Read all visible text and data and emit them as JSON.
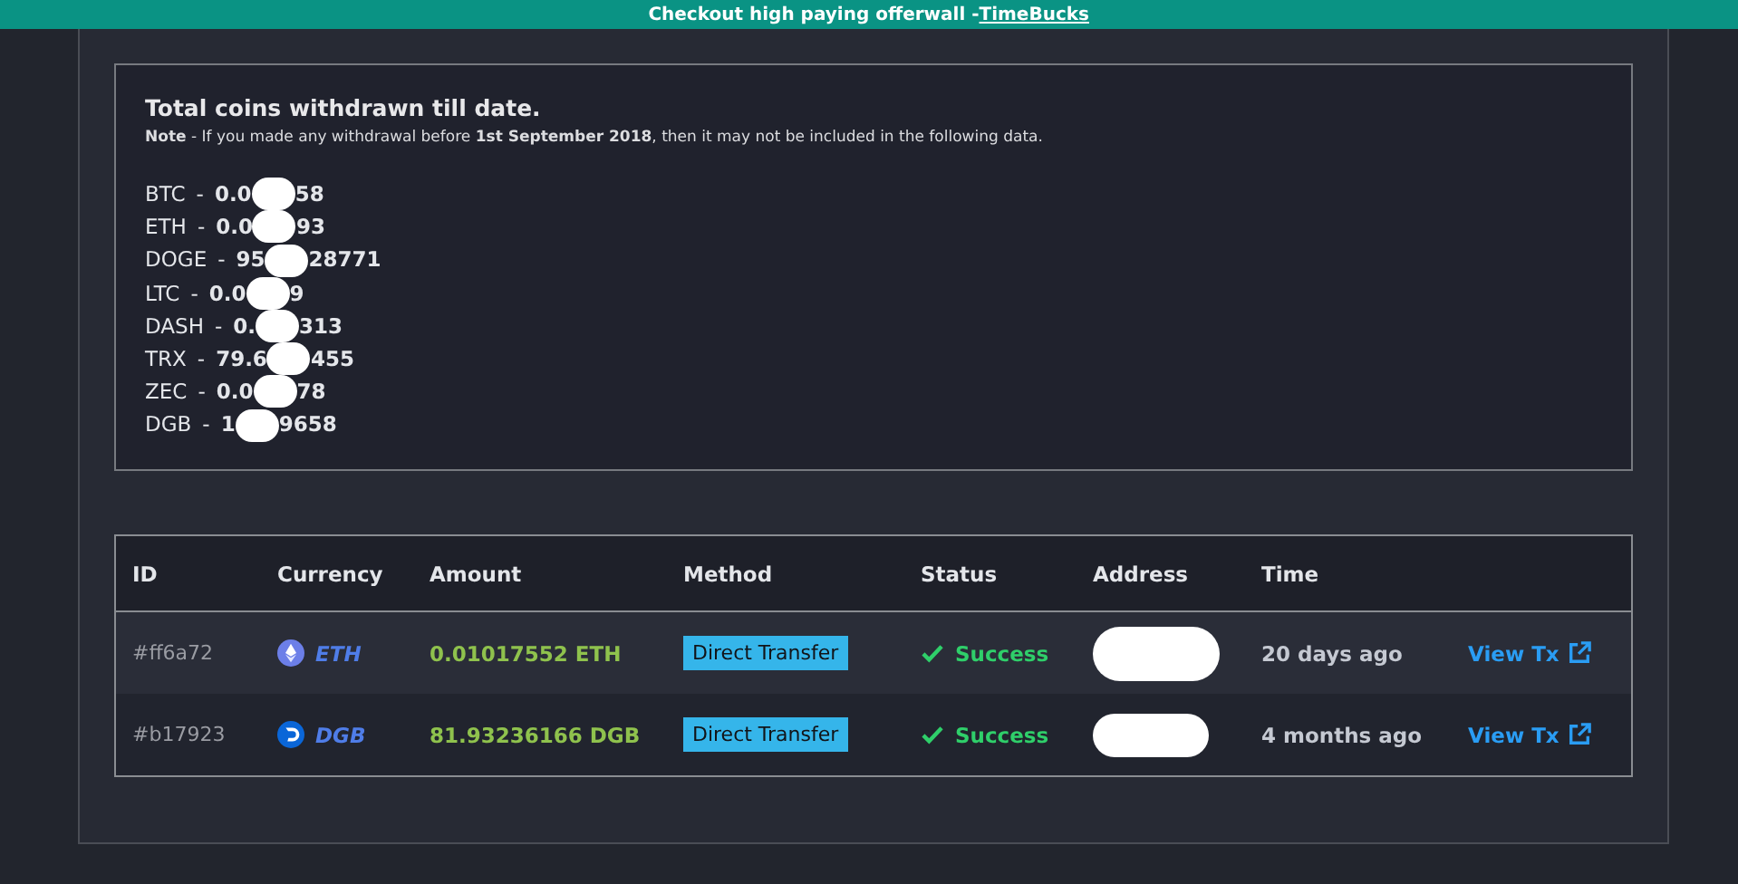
{
  "banner": {
    "text": "Checkout high paying offerwall - ",
    "link": "TimeBucks"
  },
  "summary": {
    "title": "Total coins withdrawn till date.",
    "note": "**Note** - If you made any withdrawal before **1st September 2018**, then it may not be included in the following data.",
    "coins": [
      {
        "currency": "BTC",
        "separator": "-",
        "value_start": "0.0",
        "value_end": "58"
      },
      {
        "currency": "ETH",
        "separator": "-",
        "value_start": "0.0",
        "value_end": "93"
      },
      {
        "currency": "DOGE",
        "separator": "-",
        "value_start": "95",
        "value_end": "28771"
      },
      {
        "currency": "LTC",
        "separator": "-",
        "value_start": "0.0",
        "value_end": "9"
      },
      {
        "currency": "DASH",
        "separator": "-",
        "value_start": "0.",
        "value_end": "313"
      },
      {
        "currency": "TRX",
        "separator": "-",
        "value_start": "79.6",
        "value_end": "455"
      },
      {
        "currency": "ZEC",
        "separator": "-",
        "value_start": "0.0",
        "value_end": "78"
      },
      {
        "currency": "DGB",
        "separator": "-",
        "value_start": "1",
        "value_end": "9658"
      }
    ]
  },
  "table": {
    "columns": [
      "ID",
      "Currency",
      "Amount",
      "Method",
      "Status",
      "Address",
      "Time"
    ],
    "rows": [
      {
        "id": "#ff6a72",
        "kind": "eth",
        "currency": "ETH",
        "amount": "0.01017552 ETH",
        "method": "Direct Transfer",
        "status": "Success",
        "time": "20 days ago",
        "link": "View Tx"
      },
      {
        "id": "#b17923",
        "kind": "dgb",
        "currency": "DGB",
        "amount": "81.93236166 DGB",
        "method": "Direct Transfer",
        "status": "Success",
        "time": "4 months ago",
        "link": "View Tx"
      }
    ]
  }
}
